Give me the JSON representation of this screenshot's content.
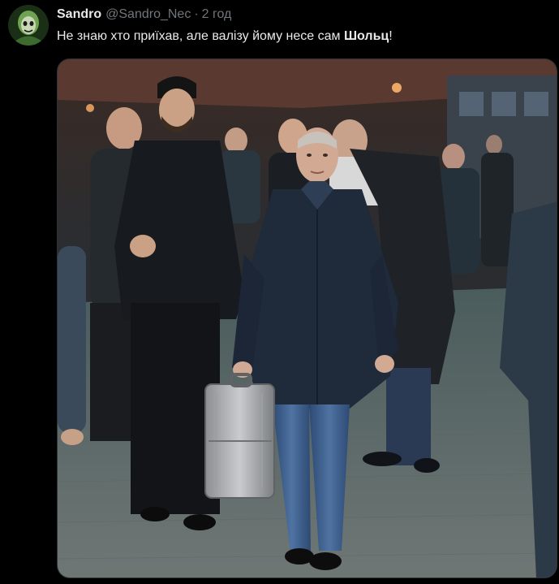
{
  "tweet": {
    "author_name": "Sandro",
    "handle": "@Sandro_Nec",
    "separator": "·",
    "time": "2 год",
    "text_plain": "Не знаю хто приїхав, але валізу йому несе сам ",
    "text_bold": "Шольц",
    "text_end": "!"
  },
  "media": {
    "description_icon": "photo"
  },
  "colors": {
    "background": "#000000",
    "primary_text": "#e7e9ea",
    "secondary_text": "#71767b",
    "border": "#2f3336"
  }
}
